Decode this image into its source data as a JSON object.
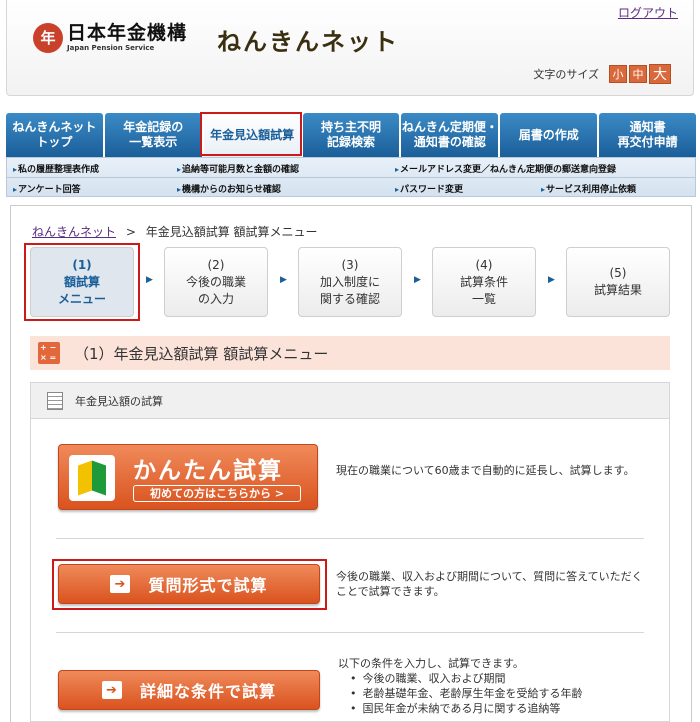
{
  "header": {
    "logo_mark": "年",
    "logo_jp": "日本年金機構",
    "logo_en": "Japan Pension Service",
    "site_title": "ねんきんネット",
    "logout": "ログアウト",
    "font_size_label": "文字のサイズ",
    "font_sizes": [
      "小",
      "中",
      "大"
    ]
  },
  "nav": {
    "tabs": [
      {
        "label": "ねんきんネット\nトップ",
        "active": false
      },
      {
        "label": "年金記録の\n一覧表示",
        "active": false
      },
      {
        "label": "年金見込額試算",
        "active": true
      },
      {
        "label": "持ち主不明\n記録検索",
        "active": false
      },
      {
        "label": "ねんきん定期便・\n通知書の確認",
        "active": false
      },
      {
        "label": "届書の作成",
        "active": false
      },
      {
        "label": "通知書\n再交付申請",
        "active": false
      }
    ],
    "sub_row1": [
      "私の履歴整理表作成",
      "追納等可能月数と金額の確認",
      "メールアドレス変更／ねんきん定期便の郵送意向登録"
    ],
    "sub_row2": [
      "アンケート回答",
      "機構からのお知らせ確認",
      "パスワード変更",
      "サービス利用停止依頼"
    ]
  },
  "breadcrumb": {
    "home": "ねんきんネット",
    "separator": ">",
    "current": "年金見込額試算 額試算メニュー"
  },
  "steps": [
    {
      "label": "(1)\n額試算\nメニュー",
      "current": true
    },
    {
      "label": "(2)\n今後の職業\nの入力",
      "current": false
    },
    {
      "label": "(3)\n加入制度に\n関する確認",
      "current": false
    },
    {
      "label": "(4)\n試算条件\n一覧",
      "current": false
    },
    {
      "label": "(5)\n試算結果",
      "current": false
    }
  ],
  "step_arrow": "▶",
  "section_title": "（1）年金見込額試算 額試算メニュー",
  "panel_title": "年金見込額の試算",
  "options": {
    "easy": {
      "label": "かんたん試算",
      "sub": "初めての方はこちらから >",
      "desc": "現在の職業について60歳まで自動的に延長し、試算します。"
    },
    "question": {
      "label": "質問形式で試算",
      "desc": "今後の職業、収入および期間について、質問に答えていただくことで試算できます。"
    },
    "detail": {
      "label": "詳細な条件で試算",
      "desc": "以下の条件を入力し、試算できます。",
      "items": [
        "今後の職業、収入および期間",
        "老齢基礎年金、老齢厚生年金を受給する年齢",
        "国民年金が未納である月に関する追納等"
      ]
    },
    "arrow": "➔"
  },
  "colors": {
    "accent_orange": "#d9531f",
    "nav_blue": "#1b5f99",
    "highlight_red": "#cc1a1a",
    "section_bg": "#fbe3da"
  }
}
